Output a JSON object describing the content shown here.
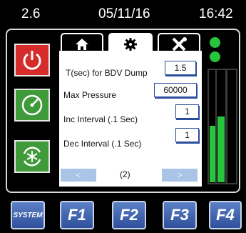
{
  "status_bar": {
    "version": "2.6",
    "date": "05/11/16",
    "time": "16:42"
  },
  "side_buttons": [
    {
      "icon": "power-icon",
      "color": "#d62b2b"
    },
    {
      "icon": "gauge-icon",
      "color": "#3f9a3a"
    },
    {
      "icon": "recycle-snowflake-icon",
      "color": "#3f9a3a"
    }
  ],
  "tabs": [
    {
      "icon": "home-icon",
      "active": false
    },
    {
      "icon": "gear-icon",
      "active": true
    },
    {
      "icon": "tools-icon",
      "active": false
    }
  ],
  "settings": [
    {
      "label": "T(sec) for BDV Dump",
      "value": "1.5"
    },
    {
      "label": "Max Pressure",
      "value": "60000"
    },
    {
      "label": "Inc Interval (.1 Sec)",
      "value": "1"
    },
    {
      "label": "Dec Interval (.1 Sec)",
      "value": "1"
    }
  ],
  "pager": {
    "prev": "<",
    "page": "(2)",
    "next": ">"
  },
  "meters": [
    {
      "level": 0.5
    },
    {
      "level": 0.58
    },
    {
      "level": 0.0
    }
  ],
  "function_keys": [
    {
      "label": "SYSTEM"
    },
    {
      "label": "F1"
    },
    {
      "label": "F2"
    },
    {
      "label": "F3"
    },
    {
      "label": "F4"
    }
  ],
  "colors": {
    "panel_blue": "#2a4d9c",
    "led_green": "#27c53c",
    "power_red": "#d62b2b"
  }
}
